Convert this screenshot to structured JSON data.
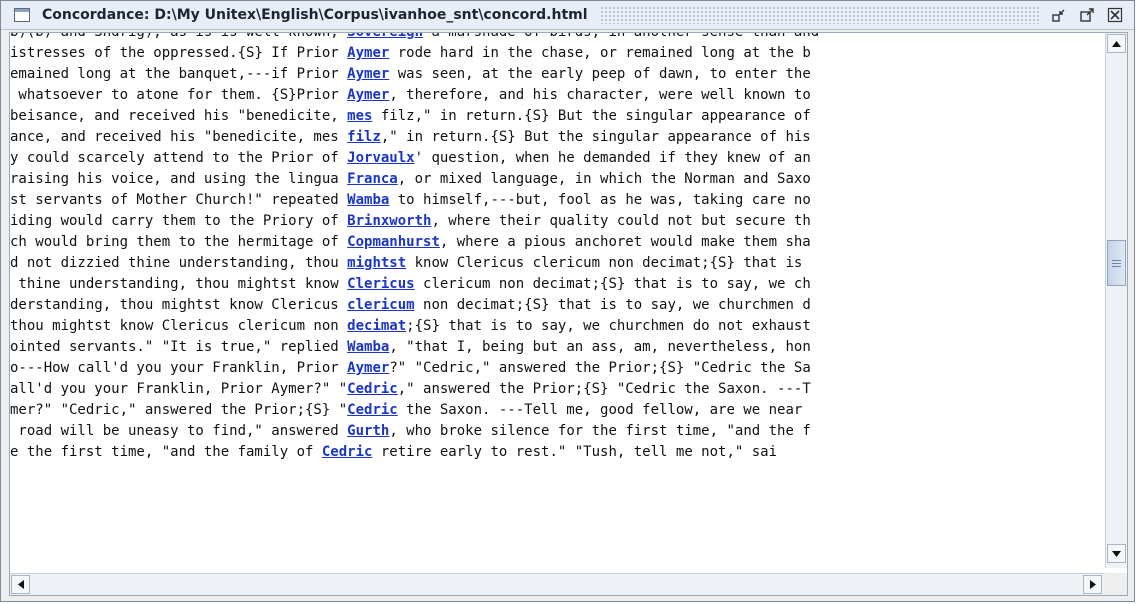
{
  "window": {
    "title": "Concordance: D:\\My Unitex\\English\\Corpus\\ivanhoe_snt\\concord.html",
    "icons": [
      "window-icon",
      "iconify-icon",
      "maximize-icon",
      "close-icon"
    ]
  },
  "colors": {
    "link": "#1a35c8",
    "text": "#111111",
    "titlebar": "#e7eef7"
  },
  "concordance": {
    "lines": [
      {
        "left": "b)(b) and Sndrig), as is is well known, ",
        "kw": "Sovereign",
        "right": " a marshade of birds, in another sense than and"
      },
      {
        "left": "istresses of the oppressed.{S} If Prior ",
        "kw": "Aymer",
        "right": " rode hard in the chase, or remained long at the b"
      },
      {
        "left": "emained long at the banquet,---if Prior ",
        "kw": "Aymer",
        "right": " was seen, at the early peep of dawn, to enter the"
      },
      {
        "left": " whatsoever to atone for them. {S}Prior ",
        "kw": "Aymer",
        "right": ", therefore, and his character, were well known to"
      },
      {
        "left": "beisance, and received his \"benedicite, ",
        "kw": "mes",
        "right": " filz,\" in return.{S} But the singular appearance of"
      },
      {
        "left": "ance, and received his \"benedicite, mes ",
        "kw": "filz",
        "right": ",\" in return.{S} But the singular appearance of his"
      },
      {
        "left": "y could scarcely attend to the Prior of ",
        "kw": "Jorvaulx",
        "right": "' question, when he demanded if they knew of an"
      },
      {
        "left": "raising his voice, and using the lingua ",
        "kw": "Franca",
        "right": ", or mixed language, in which the Norman and Saxo"
      },
      {
        "left": "st servants of Mother Church!\" repeated ",
        "kw": "Wamba",
        "right": " to himself,---but, fool as he was, taking care no"
      },
      {
        "left": "iding would carry them to the Priory of ",
        "kw": "Brinxworth",
        "right": ", where their quality could not but secure th"
      },
      {
        "left": "ch would bring them to the hermitage of ",
        "kw": "Copmanhurst",
        "right": ", where a pious anchoret would make them sha"
      },
      {
        "left": "d not dizzied thine understanding, thou ",
        "kw": "mightst",
        "right": " know Clericus clericum non decimat;{S} that is"
      },
      {
        "left": " thine understanding, thou mightst know ",
        "kw": "Clericus",
        "right": " clericum non decimat;{S} that is to say, we ch"
      },
      {
        "left": "derstanding, thou mightst know Clericus ",
        "kw": "clericum",
        "right": " non decimat;{S} that is to say, we churchmen d"
      },
      {
        "left": "thou mightst know Clericus clericum non ",
        "kw": "decimat",
        "right": ";{S} that is to say, we churchmen do not exhaust"
      },
      {
        "left": "ointed servants.\" \"It is true,\" replied ",
        "kw": "Wamba",
        "right": ", \"that I, being but an ass, am, nevertheless, hon"
      },
      {
        "left": "o---How call'd you your Franklin, Prior ",
        "kw": "Aymer",
        "right": "?\" \"Cedric,\" answered the Prior;{S} \"Cedric the Sa"
      },
      {
        "left": "all'd you your Franklin, Prior Aymer?\" \"",
        "kw": "Cedric",
        "right": ",\" answered the Prior;{S} \"Cedric the Saxon. ---T"
      },
      {
        "left": "mer?\" \"Cedric,\" answered the Prior;{S} \"",
        "kw": "Cedric",
        "right": " the Saxon. ---Tell me, good fellow, are we near"
      },
      {
        "left": " road will be uneasy to find,\" answered ",
        "kw": "Gurth",
        "right": ", who broke silence for the first time, \"and the f"
      },
      {
        "left": "e the first time, \"and the family of ",
        "kw": "Cedric",
        "right": " retire early to rest.\" \"Tush, tell me not,\" sai"
      }
    ]
  }
}
